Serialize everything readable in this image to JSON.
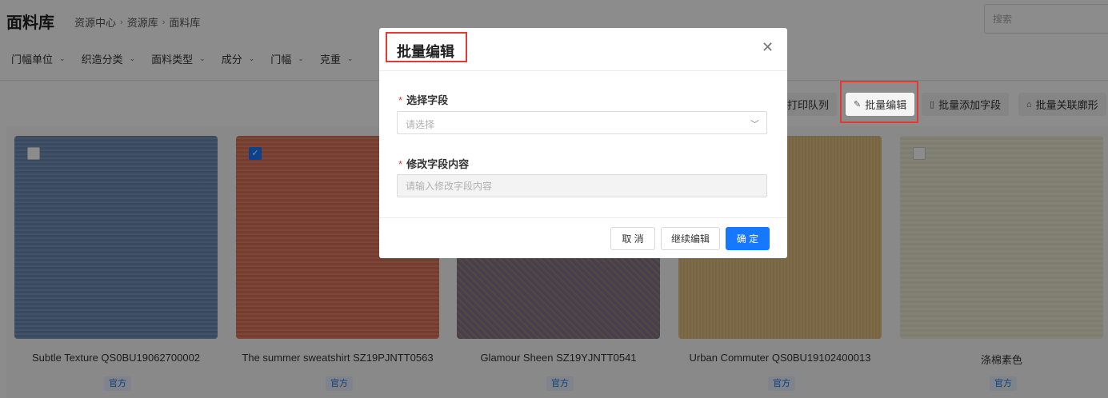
{
  "header": {
    "title": "面料库",
    "breadcrumb": [
      "资源中心",
      "资源库",
      "面料库"
    ],
    "search_placeholder": "搜索"
  },
  "filters": [
    "门幅单位",
    "织造分类",
    "面料类型",
    "成分",
    "门幅",
    "克重"
  ],
  "toolbar": {
    "print_queue": "打印队列",
    "batch_edit": "批量编辑",
    "batch_add_field": "批量添加字段",
    "batch_link_silhouette": "批量关联廓形"
  },
  "cards": [
    {
      "name": "Subtle Texture QS0BU19062700002",
      "tag": "官方",
      "checked": false,
      "color": "#6f8fb8"
    },
    {
      "name": "The summer sweatshirt SZ19PJNTT0563",
      "tag": "官方",
      "checked": true,
      "color": "#e0765a"
    },
    {
      "name": "Glamour Sheen SZ19YJNTT0541",
      "tag": "官方",
      "checked": false,
      "color": "#8a8090"
    },
    {
      "name": "Urban Commuter QS0BU19102400013",
      "tag": "官方",
      "checked": false,
      "color": "#e2bf7c"
    },
    {
      "name": "涤棉素色",
      "tag": "官方",
      "checked": false,
      "color": "#ecead2"
    }
  ],
  "modal": {
    "title": "批量编辑",
    "field1_label": "选择字段",
    "field1_placeholder": "请选择",
    "field2_label": "修改字段内容",
    "field2_placeholder": "请输入修改字段内容",
    "cancel": "取 消",
    "continue": "继续编辑",
    "ok": "确 定"
  }
}
